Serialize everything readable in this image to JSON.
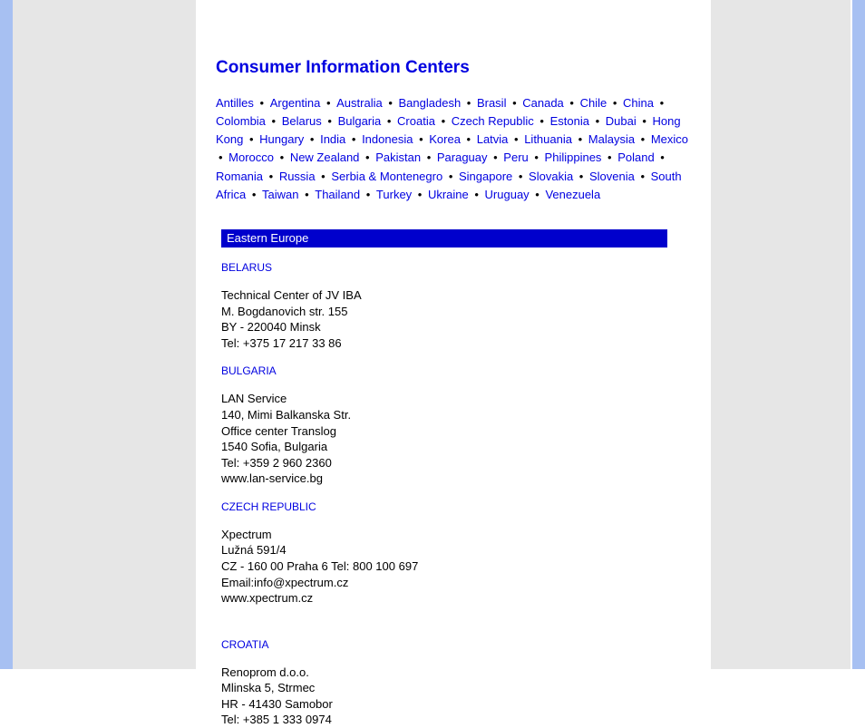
{
  "title": "Consumer Information Centers",
  "countries": [
    "Antilles",
    "Argentina",
    "Australia",
    "Bangladesh",
    "Brasil",
    "Canada",
    "Chile",
    "China",
    "Colombia",
    "Belarus",
    "Bulgaria",
    "Croatia",
    "Czech Republic",
    "Estonia",
    "Dubai",
    "Hong Kong",
    "Hungary",
    "India",
    "Indonesia",
    "Korea",
    "Latvia",
    "Lithuania",
    "Malaysia",
    "Mexico",
    "Morocco",
    "New Zealand",
    "Pakistan",
    "Paraguay",
    "Peru",
    "Philippines",
    "Poland",
    "Romania",
    "Russia",
    "Serbia & Montenegro",
    "Singapore",
    "Slovakia",
    "Slovenia",
    "South Africa",
    "Taiwan",
    "Thailand",
    "Turkey",
    "Ukraine",
    "Uruguay",
    "Venezuela"
  ],
  "region": "Eastern Europe",
  "entries": [
    {
      "country": "BELARUS",
      "lines": [
        "Technical Center of JV IBA",
        "M. Bogdanovich str. 155",
        "BY - 220040 Minsk",
        "Tel: +375 17 217 33 86"
      ]
    },
    {
      "country": "BULGARIA",
      "lines": [
        "LAN Service",
        "140, Mimi Balkanska Str.",
        "Office center Translog",
        "1540 Sofia, Bulgaria",
        "Tel: +359 2 960 2360",
        "www.lan-service.bg"
      ]
    },
    {
      "country": "CZECH REPUBLIC",
      "lines": [
        "Xpectrum",
        "Lužná 591/4",
        "CZ - 160 00 Praha 6 Tel: 800 100 697",
        "Email:info@xpectrum.cz",
        "www.xpectrum.cz"
      ]
    },
    {
      "country": "CROATIA",
      "lines": [
        "Renoprom d.o.o.",
        "Mlinska 5, Strmec",
        "HR - 41430 Samobor",
        "Tel: +385 1 333 0974"
      ]
    }
  ]
}
